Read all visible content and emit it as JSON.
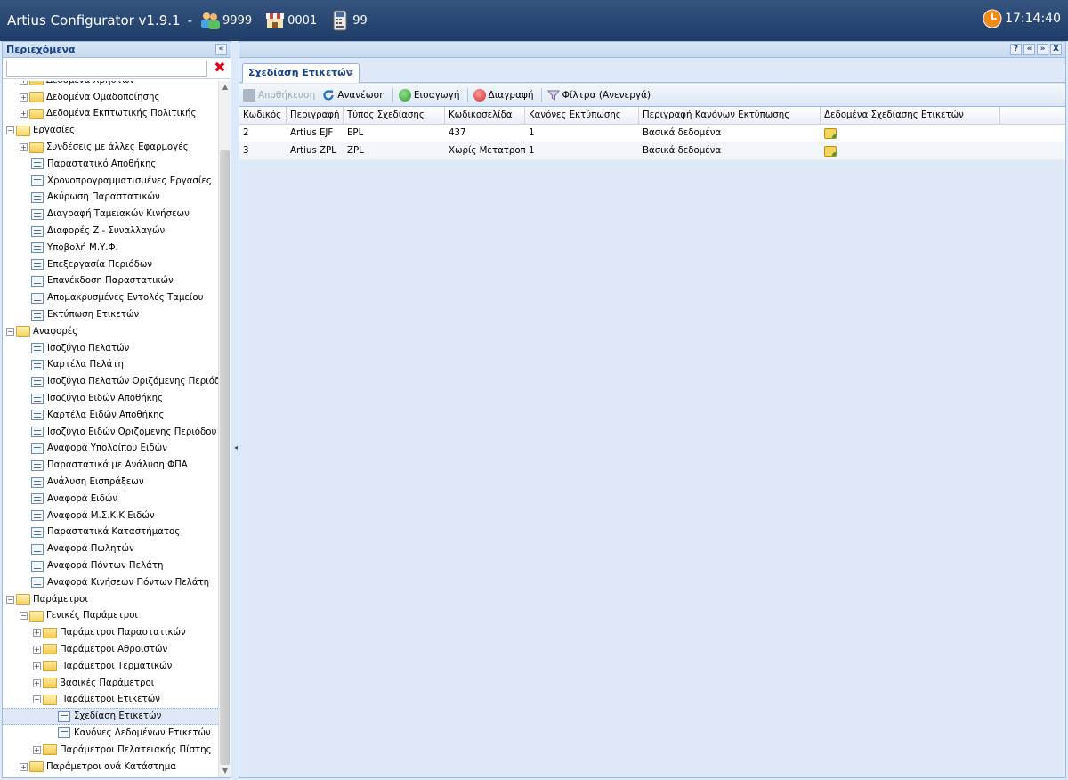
{
  "header": {
    "app_title": "Artius Configurator v1.9.1",
    "separator": "-",
    "stats": [
      {
        "icon": "users-icon",
        "value": "9999"
      },
      {
        "icon": "store-icon",
        "value": "0001"
      },
      {
        "icon": "cash-register-icon",
        "value": "99"
      }
    ],
    "clock": {
      "icon": "clock-icon",
      "time": "17:14:40"
    }
  },
  "left_panel": {
    "title": "Περιεχόμενα",
    "collapse": "«",
    "search": {
      "value": "",
      "placeholder": ""
    },
    "clear": "✖",
    "tree": [
      {
        "label": "Δεδομένα Χρήστών",
        "level": 1,
        "type": "folder"
      },
      {
        "label": "Δεδομένα Ομαδοποίησης",
        "level": 1,
        "type": "folder"
      },
      {
        "label": "Δεδομένα Εκπτωτικής Πολιτικής",
        "level": 1,
        "type": "folder"
      },
      {
        "label": "Εργασίες",
        "level": 0,
        "type": "folder-open"
      },
      {
        "label": "Συνδέσεις με άλλες Εφαρμογές",
        "level": 1,
        "type": "folder"
      },
      {
        "label": "Παραστατικό Αποθήκης",
        "level": 1,
        "type": "leaf"
      },
      {
        "label": "Χρονοπρογραμματισμένες Εργασίες",
        "level": 1,
        "type": "leaf"
      },
      {
        "label": "Ακύρωση Παραστατικών",
        "level": 1,
        "type": "leaf"
      },
      {
        "label": "Διαγραφή Ταμειακών Κινήσεων",
        "level": 1,
        "type": "leaf"
      },
      {
        "label": "Διαφορές Ζ - Συναλλαγών",
        "level": 1,
        "type": "leaf"
      },
      {
        "label": "Υποβολή Μ.Υ.Φ.",
        "level": 1,
        "type": "leaf"
      },
      {
        "label": "Επεξεργασία Περιόδων",
        "level": 1,
        "type": "leaf"
      },
      {
        "label": "Επανέκδοση Παραστατικών",
        "level": 1,
        "type": "leaf"
      },
      {
        "label": "Απομακρυσμένες Εντολές Ταμείου",
        "level": 1,
        "type": "leaf"
      },
      {
        "label": "Εκτύπωση Ετικετών",
        "level": 1,
        "type": "leaf"
      },
      {
        "label": "Αναφορές",
        "level": 0,
        "type": "folder-open"
      },
      {
        "label": "Ισοζύγιο Πελατών",
        "level": 1,
        "type": "leaf"
      },
      {
        "label": "Καρτέλα Πελάτη",
        "level": 1,
        "type": "leaf"
      },
      {
        "label": "Ισοζύγιο Πελατών Οριζόμενης Περιόδου",
        "level": 1,
        "type": "leaf"
      },
      {
        "label": "Ισοζύγιο Ειδών Αποθήκης",
        "level": 1,
        "type": "leaf"
      },
      {
        "label": "Καρτέλα Ειδών Αποθήκης",
        "level": 1,
        "type": "leaf"
      },
      {
        "label": "Ισοζύγιο Ειδών Οριζόμενης Περιόδου",
        "level": 1,
        "type": "leaf"
      },
      {
        "label": "Αναφορά Υπολοίπου Ειδών",
        "level": 1,
        "type": "leaf"
      },
      {
        "label": "Παραστατικά με Ανάλυση ΦΠΑ",
        "level": 1,
        "type": "leaf"
      },
      {
        "label": "Ανάλυση Εισπράξεων",
        "level": 1,
        "type": "leaf"
      },
      {
        "label": "Αναφορά Ειδών",
        "level": 1,
        "type": "leaf"
      },
      {
        "label": "Αναφορά Μ.Σ.Κ.Κ Ειδών",
        "level": 1,
        "type": "leaf"
      },
      {
        "label": "Παραστατικά Καταστήματος",
        "level": 1,
        "type": "leaf"
      },
      {
        "label": "Αναφορά Πωλητών",
        "level": 1,
        "type": "leaf"
      },
      {
        "label": "Αναφορά Πόντων Πελάτη",
        "level": 1,
        "type": "leaf"
      },
      {
        "label": "Αναφορά Κινήσεων Πόντων Πελάτη",
        "level": 1,
        "type": "leaf"
      },
      {
        "label": "Παράμετροι",
        "level": 0,
        "type": "folder-open"
      },
      {
        "label": "Γενικές Παράμετροι",
        "level": 1,
        "type": "folder-open"
      },
      {
        "label": "Παράμετροι Παραστατικών",
        "level": 2,
        "type": "folder"
      },
      {
        "label": "Παράμετροι Αθροιστών",
        "level": 2,
        "type": "folder"
      },
      {
        "label": "Παράμετροι Τερματικών",
        "level": 2,
        "type": "folder"
      },
      {
        "label": "Βασικές Παράμετροι",
        "level": 2,
        "type": "folder"
      },
      {
        "label": "Παράμετροι Ετικετών",
        "level": 2,
        "type": "folder-open"
      },
      {
        "label": "Σχεδίαση Ετικετών",
        "level": 3,
        "type": "leaf",
        "selected": true
      },
      {
        "label": "Κανόνες Δεδομένων Ετικετών",
        "level": 3,
        "type": "leaf"
      },
      {
        "label": "Παράμετροι Πελατειακής Πίστης",
        "level": 2,
        "type": "folder"
      },
      {
        "label": "Παράμετροι ανά Κατάστημα",
        "level": 1,
        "type": "folder"
      }
    ]
  },
  "main": {
    "header_tools": [
      "?",
      "«",
      "»",
      "X"
    ],
    "tab": {
      "label": "Σχεδίαση Ετικετών",
      "close": "×"
    },
    "toolbar": {
      "save": "Αποθήκευση",
      "refresh": "Ανανέωση",
      "insert": "Εισαγωγή",
      "delete": "Διαγραφή",
      "filters": "Φίλτρα (Ανενεργά)"
    },
    "grid": {
      "columns": [
        "Κωδικός",
        "Περιγραφή",
        "Τύπος Σχεδίασης",
        "Κωδικοσελίδα",
        "Κανόνες Εκτύπωσης",
        "Περιγραφή Κανόνων Εκτύπωσης",
        "Δεδομένα Σχεδίασης Ετικετών"
      ],
      "rows": [
        [
          "2",
          "Artius EJF",
          "EPL",
          "437",
          "1",
          "Βασικά δεδομένα",
          "label-data-icon"
        ],
        [
          "3",
          "Artius ZPL",
          "ZPL",
          "Χωρίς Μετατροπή",
          "1",
          "Βασικά δεδομένα",
          "label-data-icon"
        ]
      ]
    }
  },
  "colors": {
    "topbar": "#294874",
    "panel_bg": "#dfe8f6",
    "header_text": "#15428b",
    "border": "#99bbe8"
  }
}
